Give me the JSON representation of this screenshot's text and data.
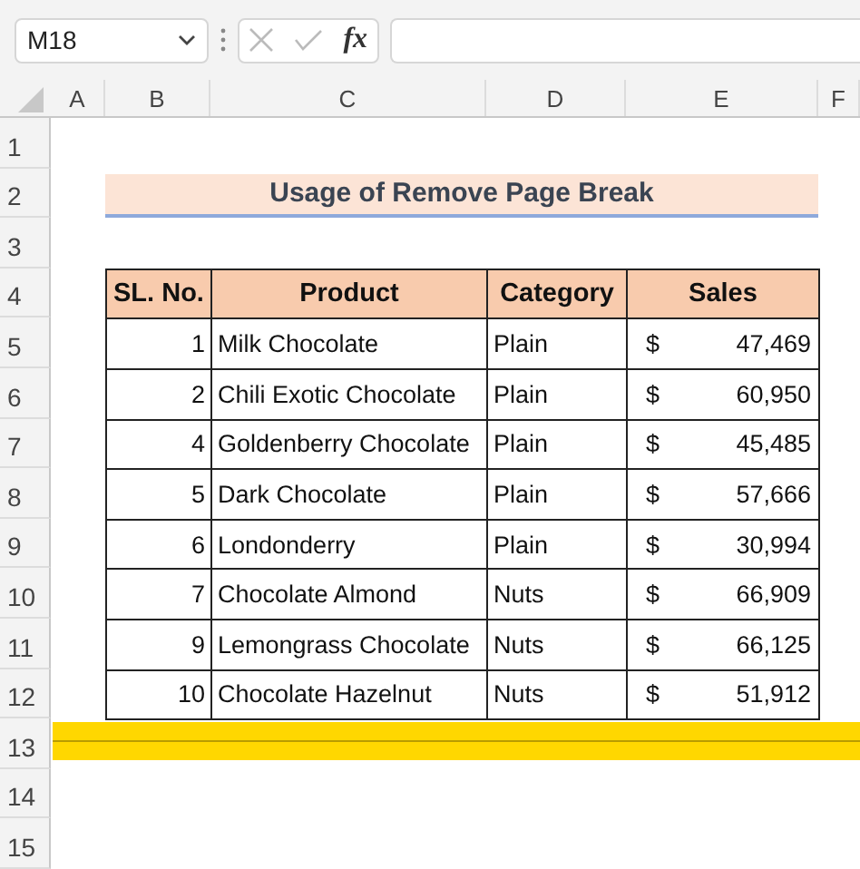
{
  "name_box": {
    "value": "M18"
  },
  "formula_bar": {
    "function_label": "fx"
  },
  "column_headers": [
    "A",
    "B",
    "C",
    "D",
    "E",
    "F"
  ],
  "row_numbers": [
    "1",
    "2",
    "3",
    "4",
    "5",
    "6",
    "7",
    "8",
    "9",
    "10",
    "11",
    "12",
    "13",
    "14",
    "15"
  ],
  "title": "Usage of Remove Page Break",
  "table": {
    "columns": [
      "SL. No.",
      "Product",
      "Category",
      "Sales"
    ],
    "rows": [
      {
        "sl": "1",
        "product": "Milk Chocolate",
        "category": "Plain",
        "currency": "$",
        "sales": "47,469"
      },
      {
        "sl": "2",
        "product": "Chili Exotic Chocolate",
        "category": "Plain",
        "currency": "$",
        "sales": "60,950"
      },
      {
        "sl": "4",
        "product": "Goldenberry Chocolate",
        "category": "Plain",
        "currency": "$",
        "sales": "45,485"
      },
      {
        "sl": "5",
        "product": "Dark Chocolate",
        "category": "Plain",
        "currency": "$",
        "sales": "57,666"
      },
      {
        "sl": "6",
        "product": "Londonderry",
        "category": "Plain",
        "currency": "$",
        "sales": "30,994"
      },
      {
        "sl": "7",
        "product": "Chocolate Almond",
        "category": "Nuts",
        "currency": "$",
        "sales": "66,909"
      },
      {
        "sl": "9",
        "product": "Lemongrass Chocolate",
        "category": "Nuts",
        "currency": "$",
        "sales": "66,125"
      },
      {
        "sl": "10",
        "product": "Chocolate Hazelnut",
        "category": "Nuts",
        "currency": "$",
        "sales": "51,912"
      }
    ]
  },
  "page_break": {
    "highlighted": true
  }
}
